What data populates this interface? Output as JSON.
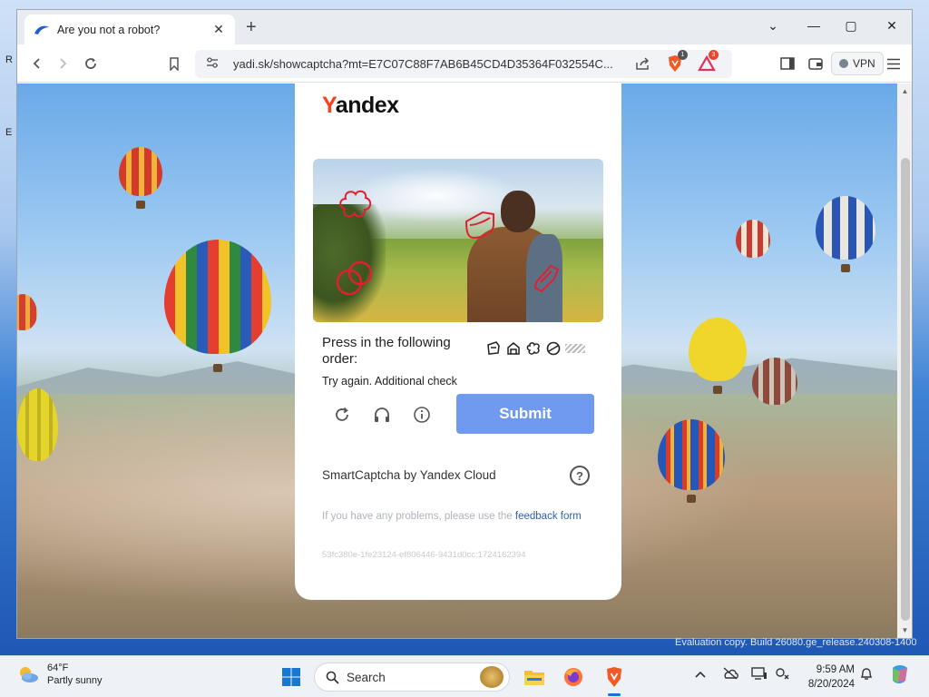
{
  "desktop": {
    "watermark": "Evaluation copy. Build 26080.ge_release.240308-1400"
  },
  "browser": {
    "tab": {
      "title": "Are you not a robot?",
      "close": "✕"
    },
    "new_tab": "+",
    "window_controls": {
      "dropdown": "⌄",
      "minimize": "—",
      "maximize": "▢",
      "close": "✕"
    },
    "url": "yadi.sk/showcaptcha?mt=E7C07C88F7AB6B45CD4D35364F032554C...",
    "vpn_label": "VPN",
    "shields_badge": "1",
    "rewards_badge": "3"
  },
  "captcha": {
    "brand_logo": "Yandex",
    "prompt": "Press in the following order:",
    "status": "Try again. Additional check",
    "submit_label": "Submit",
    "powered_by": "SmartCaptcha by Yandex Cloud",
    "help_label": "?",
    "problems_text": "If you have any problems, please use the ",
    "feedback_link": "feedback form",
    "request_id": "53fc380e-1fe23124-ef806446-9431d0cc:1724162394"
  },
  "taskbar": {
    "weather_temp": "64°F",
    "weather_desc": "Partly sunny",
    "search_label": "Search",
    "time": "9:59 AM",
    "date": "8/20/2024"
  }
}
